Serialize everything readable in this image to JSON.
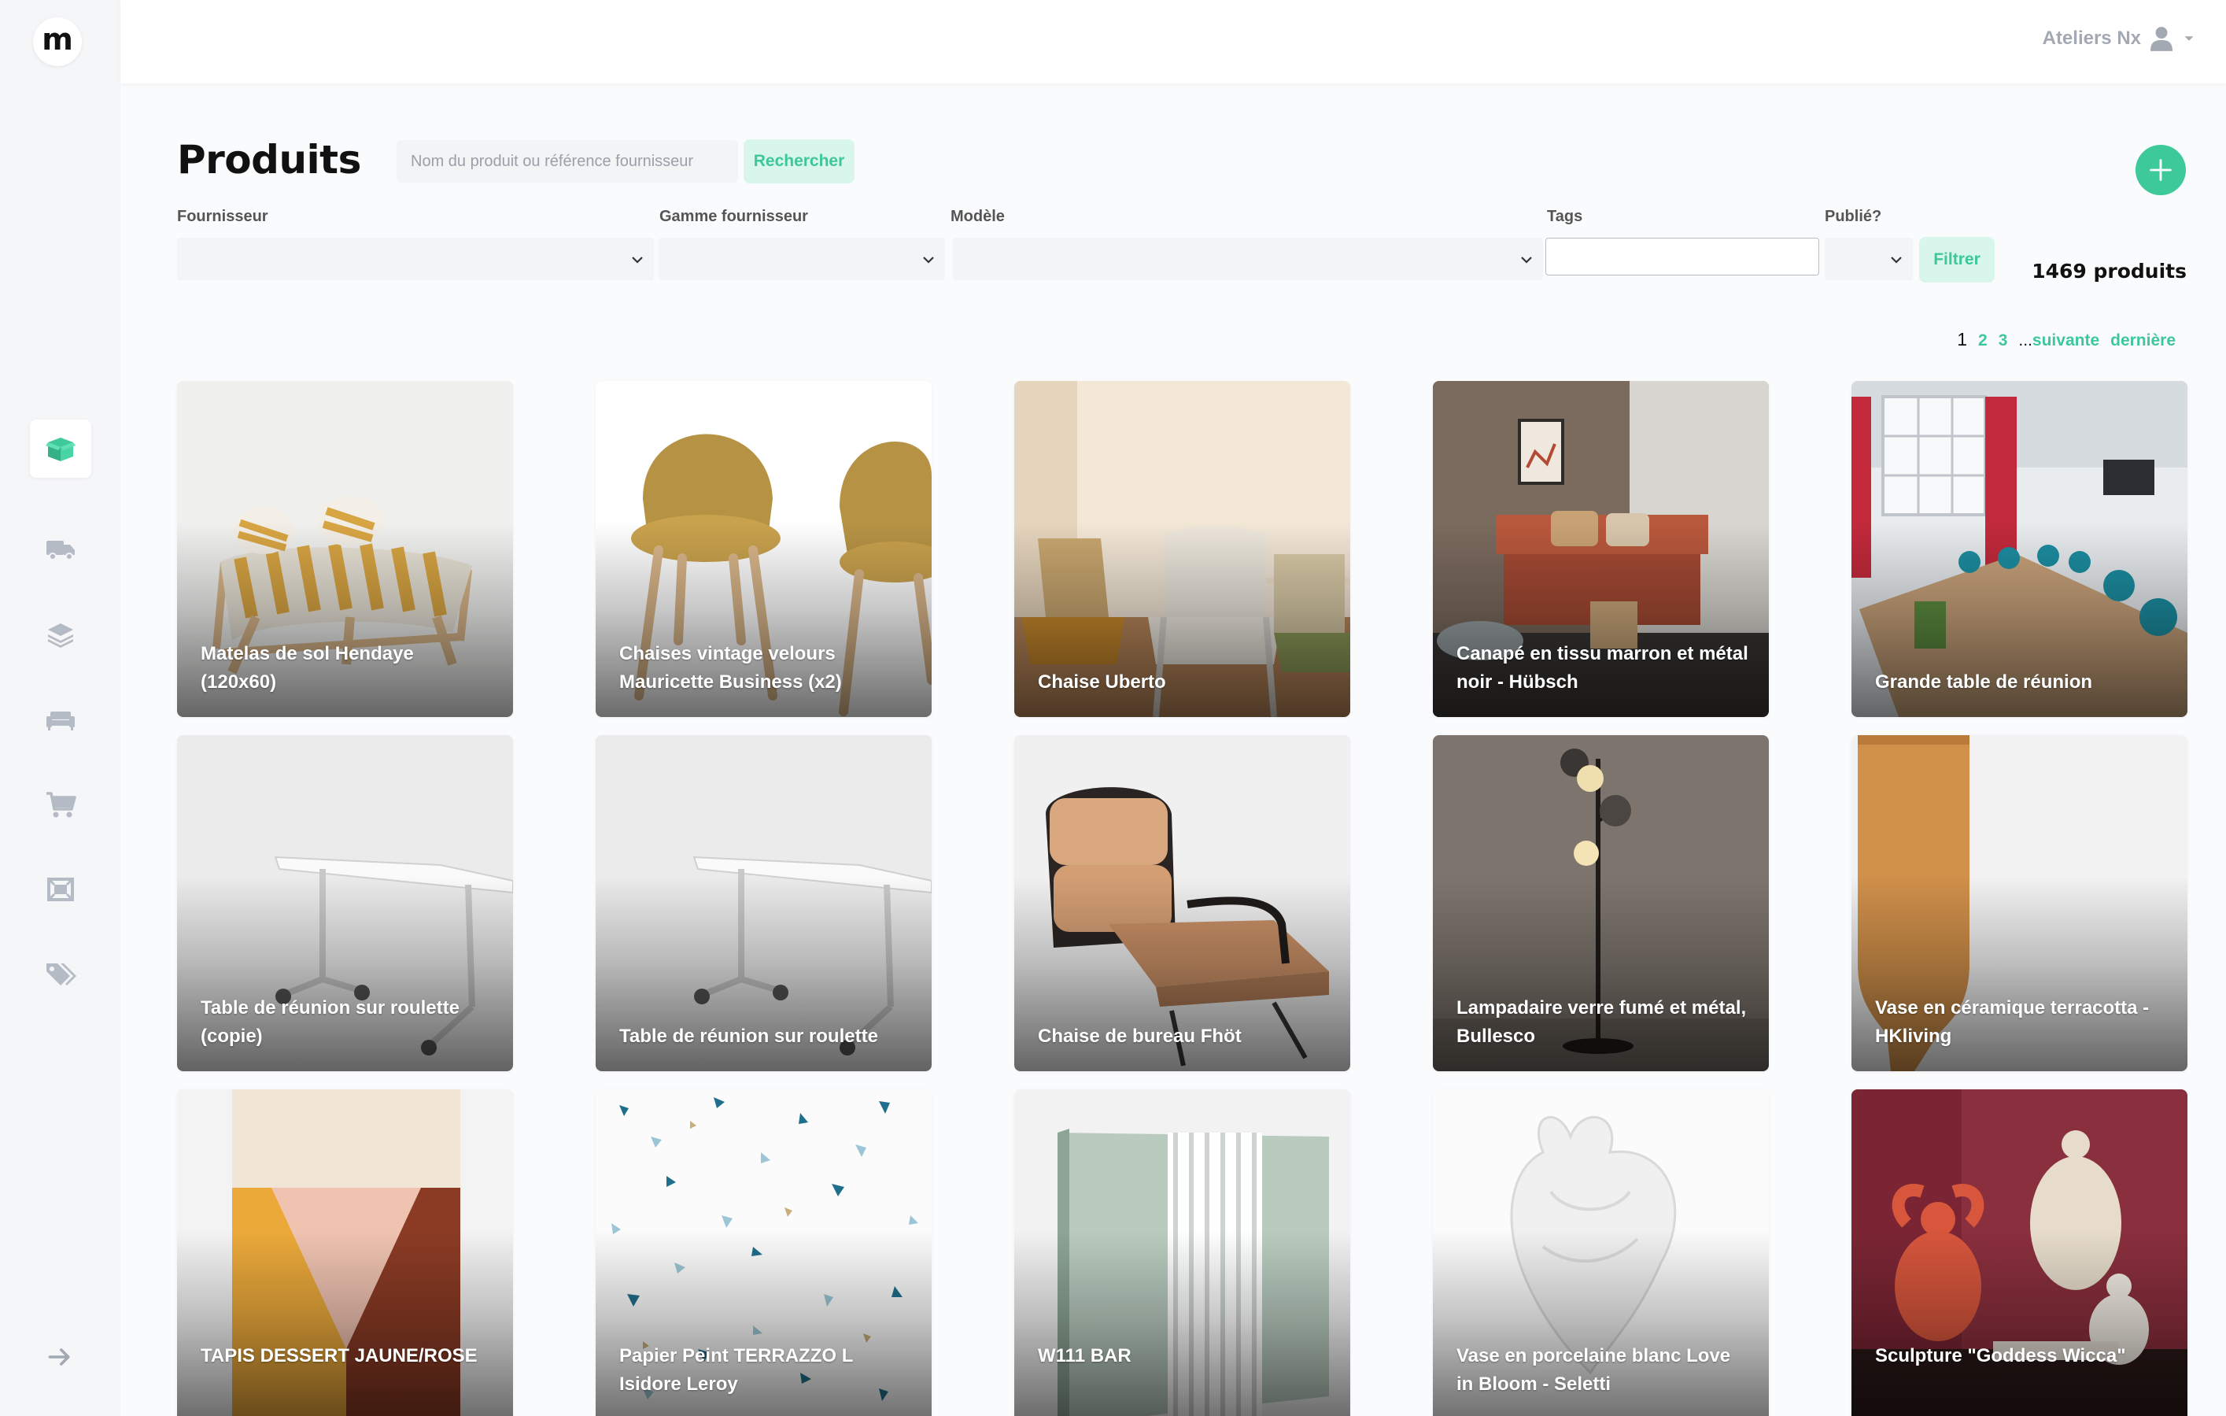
{
  "app": {
    "logo_letter": "m"
  },
  "user": {
    "name": "Ateliers Nx"
  },
  "header": {
    "title": "Produits",
    "search_placeholder": "Nom du produit ou référence fournisseur",
    "search_button": "Rechercher",
    "add_button_icon": "plus-icon"
  },
  "filters": {
    "fournisseur_label": "Fournisseur",
    "gamme_label": "Gamme fournisseur",
    "modele_label": "Modèle",
    "tags_label": "Tags",
    "publie_label": "Publié?",
    "filter_button": "Filtrer"
  },
  "count_text": "1469 produits",
  "pagination": {
    "current": "1",
    "pages": [
      "2",
      "3"
    ],
    "ellipsis": "...",
    "next": "suivante",
    "last": "dernière"
  },
  "sidebar": {
    "items": [
      {
        "name": "products",
        "icon": "box-icon",
        "active": true
      },
      {
        "name": "delivery",
        "icon": "truck-icon",
        "active": false
      },
      {
        "name": "layers",
        "icon": "layers-icon",
        "active": false
      },
      {
        "name": "furniture",
        "icon": "sofa-icon",
        "active": false
      },
      {
        "name": "cart",
        "icon": "cart-icon",
        "active": false
      },
      {
        "name": "rooms",
        "icon": "frame-icon",
        "active": false
      },
      {
        "name": "tags",
        "icon": "tags-icon",
        "active": false
      }
    ],
    "expand_icon": "arrow-right-icon"
  },
  "products": [
    {
      "name": "Matelas de sol Hendaye (120x60)"
    },
    {
      "name": "Chaises vintage velours Mauricette Business (x2)"
    },
    {
      "name": "Chaise Uberto"
    },
    {
      "name": "Canapé en tissu marron et métal noir - Hübsch"
    },
    {
      "name": "Grande table de réunion"
    },
    {
      "name": "Table de réunion sur roulette (copie)"
    },
    {
      "name": "Table de réunion sur roulette"
    },
    {
      "name": "Chaise de bureau Fhöt"
    },
    {
      "name": "Lampadaire verre fumé et métal, Bullesco"
    },
    {
      "name": "Vase en céramique terracotta - HKliving"
    },
    {
      "name": "TAPIS DESSERT JAUNE/ROSE"
    },
    {
      "name": "Papier Peint TERRAZZO L Isidore Leroy"
    },
    {
      "name": "W111 BAR"
    },
    {
      "name": "Vase en porcelaine blanc Love in Bloom - Seletti"
    },
    {
      "name": "Sculpture \"Goddess Wicca\""
    }
  ],
  "colors": {
    "accent": "#3ec99a",
    "accent_light": "#d8f6ec",
    "muted": "#a3a9b3"
  }
}
